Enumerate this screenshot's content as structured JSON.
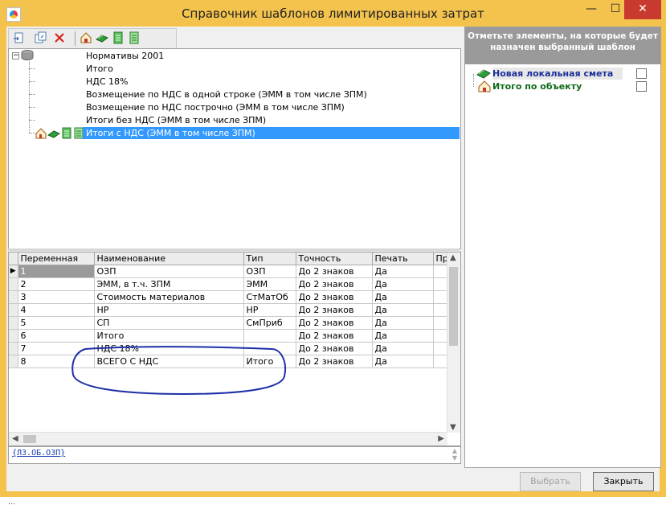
{
  "window": {
    "title": "Справочник шаблонов лимитированных затрат",
    "controls": {
      "minimize": "—",
      "maximize": "☐",
      "close": "✕"
    }
  },
  "toolbar": {
    "icons": [
      "add-template-icon",
      "copy-template-icon",
      "delete-icon",
      "object-estimate-icon",
      "local-estimate-icon",
      "section-icon",
      "document-icon"
    ]
  },
  "tree": {
    "root": "Нормативы 2001",
    "items": [
      "Итого",
      "НДС 18%",
      "Возмещение по НДС в одной строке (ЭММ в том числе ЗПМ)",
      "Возмещение по НДС построчно (ЭММ в том числе ЗПМ)",
      "Итоги без НДС (ЭММ в том числе ЗПМ)"
    ],
    "selected": "Итоги с НДС (ЭММ в том числе ЗПМ)"
  },
  "grid": {
    "columns": [
      "Переменная",
      "Наименование",
      "Тип",
      "Точность",
      "Печать",
      "Пр"
    ],
    "rows": [
      {
        "var": "1",
        "name": "ОЗП",
        "type": "ОЗП",
        "precision": "До 2 знаков",
        "print": "Да"
      },
      {
        "var": "2",
        "name": "ЭММ, в т.ч. ЗПМ",
        "type": "ЭММ",
        "precision": "До 2 знаков",
        "print": "Да"
      },
      {
        "var": "3",
        "name": "Стоимость материалов",
        "type": "СтМатОб",
        "precision": "До 2 знаков",
        "print": "Да"
      },
      {
        "var": "4",
        "name": "НР",
        "type": "НР",
        "precision": "До 2 знаков",
        "print": "Да"
      },
      {
        "var": "5",
        "name": "СП",
        "type": "СмПриб",
        "precision": "До 2 знаков",
        "print": "Да"
      },
      {
        "var": "6",
        "name": "Итого",
        "type": "",
        "precision": "До 2 знаков",
        "print": "Да"
      },
      {
        "var": "7",
        "name": "НДС 18%",
        "type": "",
        "precision": "До 2 знаков",
        "print": "Да"
      },
      {
        "var": "8",
        "name": "ВСЕГО С НДС",
        "type": "Итого",
        "precision": "До 2 знаков",
        "print": "Да"
      }
    ]
  },
  "formula": "{ЛЗ.ОБ.ОЗП}",
  "right_panel": {
    "hint": "Отметьте элементы, на которые будет назначен выбранный шаблон",
    "items": [
      {
        "label": "Новая локальная смета",
        "color": "#1a2f9a",
        "checked": false
      },
      {
        "label": "Итого по объекту",
        "color": "#0f6a1a",
        "checked": false
      }
    ]
  },
  "buttons": {
    "select": "Выбрать",
    "close": "Закрыть"
  },
  "colors": {
    "titlebar": "#f3c34d",
    "selection": "#3399ff",
    "close_button": "#c73a2d",
    "annotation": "#1e2fa8"
  }
}
